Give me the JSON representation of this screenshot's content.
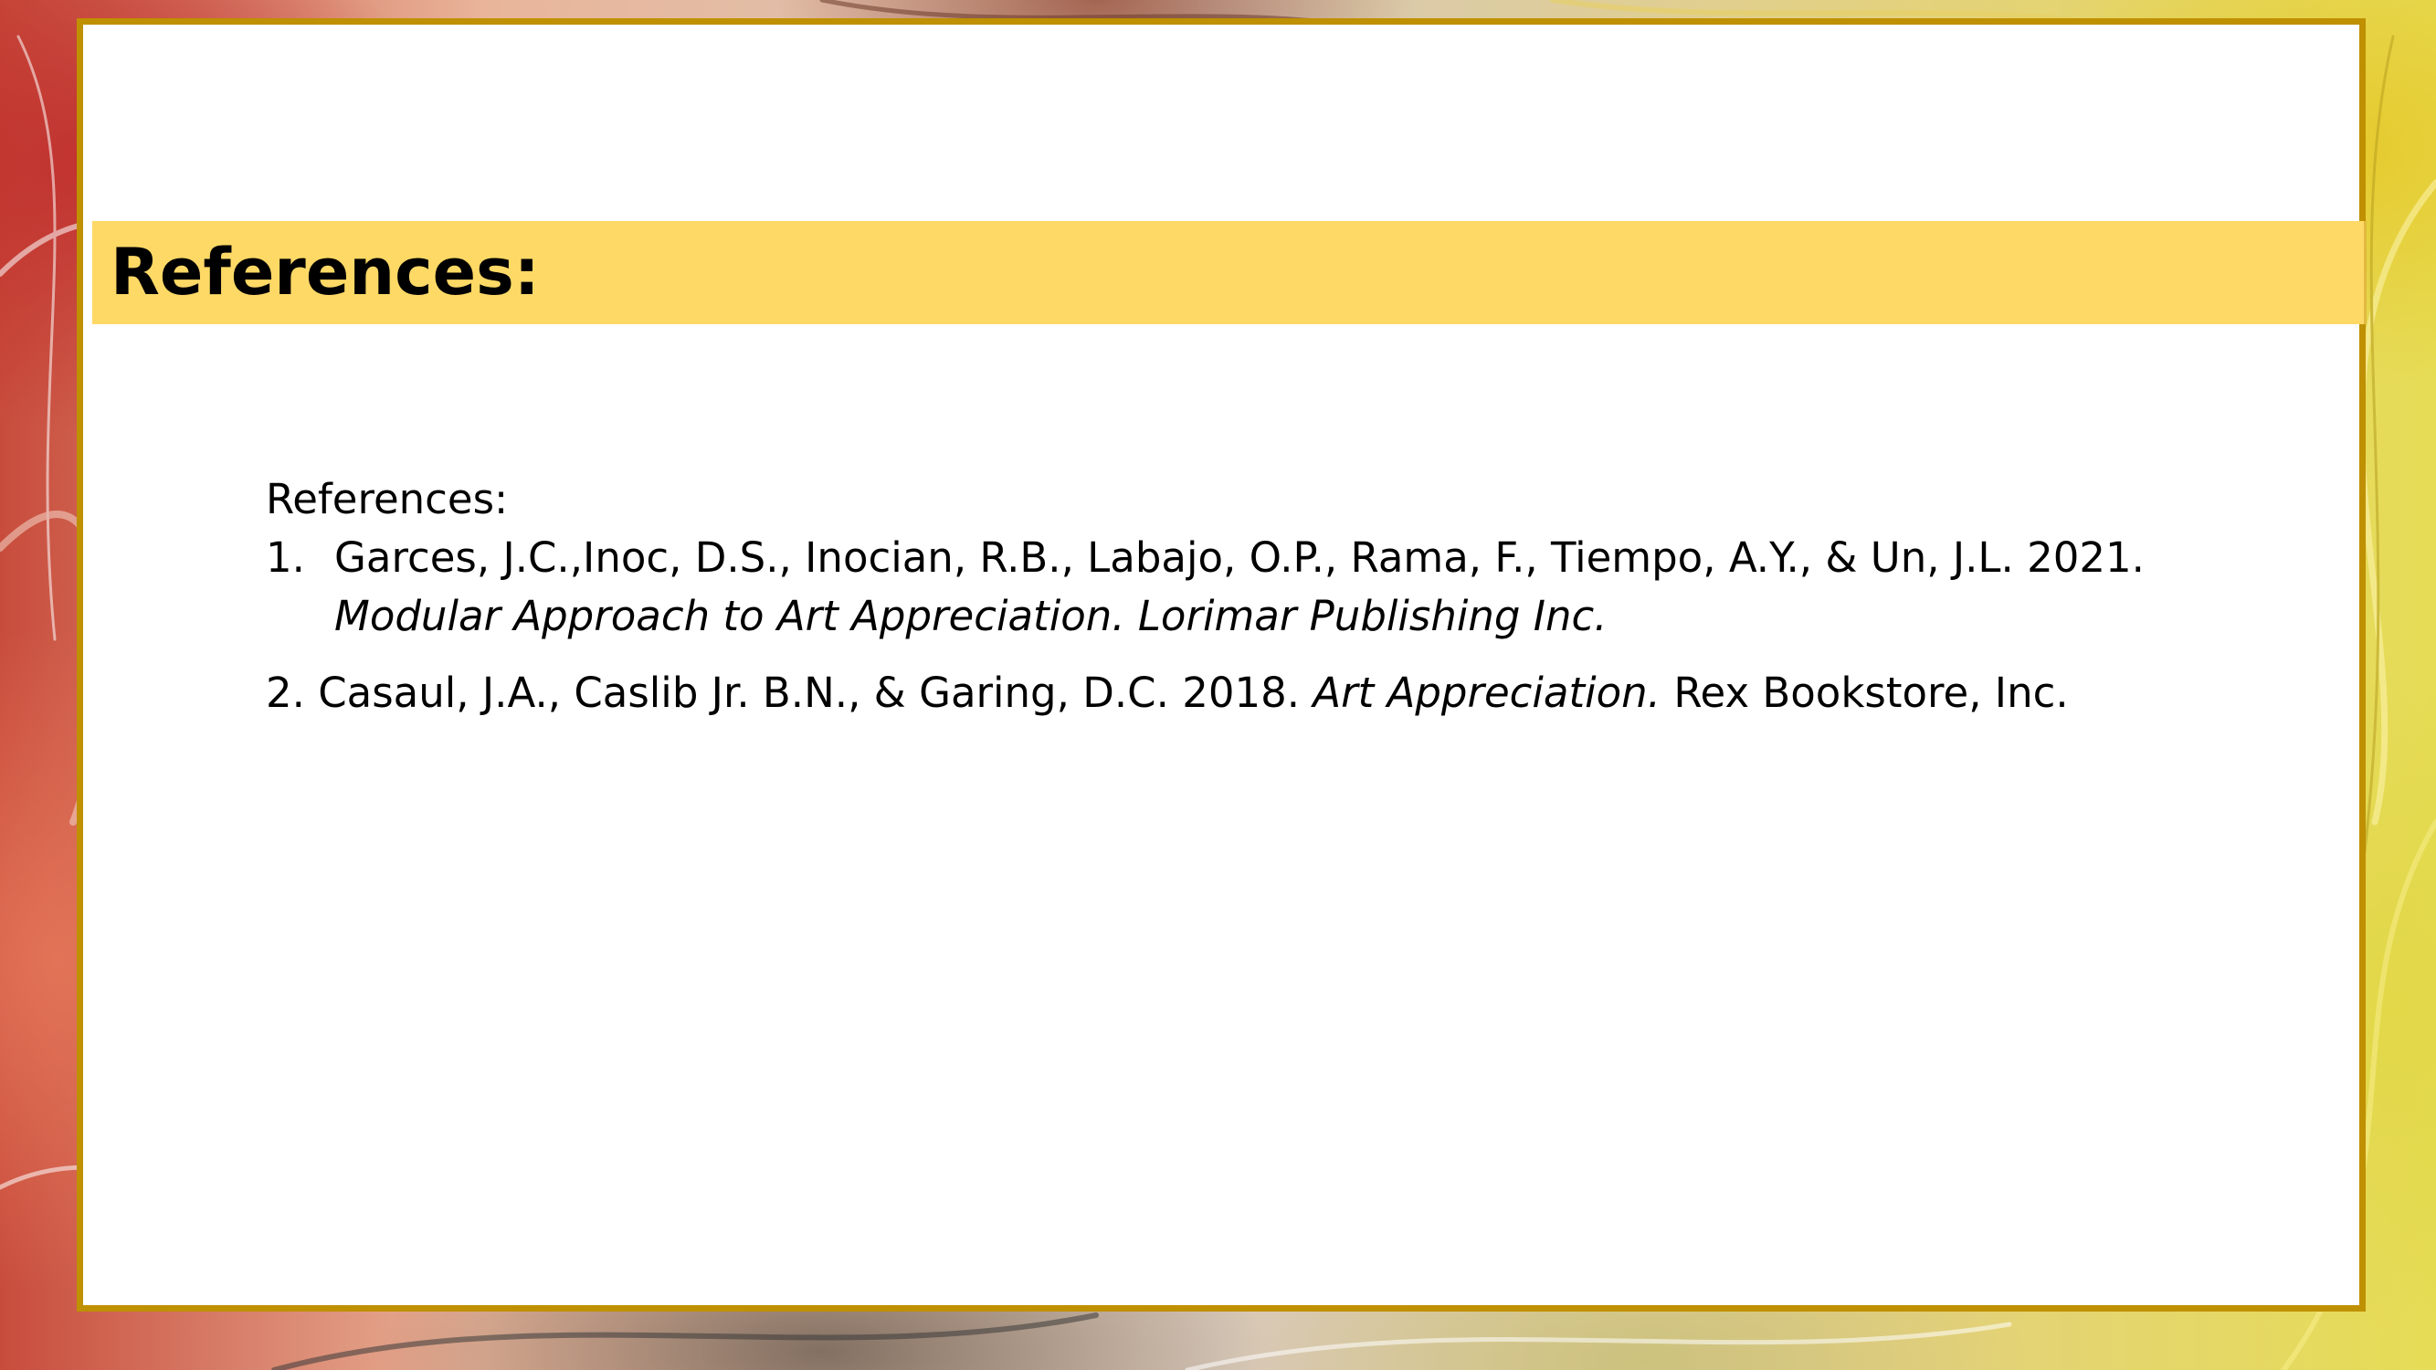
{
  "slide": {
    "title": "References:",
    "body_heading": "References:",
    "references": [
      {
        "number": "1.",
        "line1": "Garces, J.C.,Inoc, D.S., Inocian, R.B., Labajo, O.P., Rama, F., Tiempo, A.Y., & Un, J.L. 2021.",
        "line2_italic": "Modular Approach to Art Appreciation. Lorimar Publishing Inc."
      },
      {
        "prefix": "2. Casaul, J.A., Caslib Jr. B.N., & Garing, D.C. 2018.",
        "italic": "Art Appreciation.",
        "suffix": "Rex Bookstore, Inc."
      }
    ]
  },
  "colors": {
    "frame": "#bf9000",
    "title_band": "#ffd966",
    "card": "#ffffff",
    "text": "#000000"
  }
}
